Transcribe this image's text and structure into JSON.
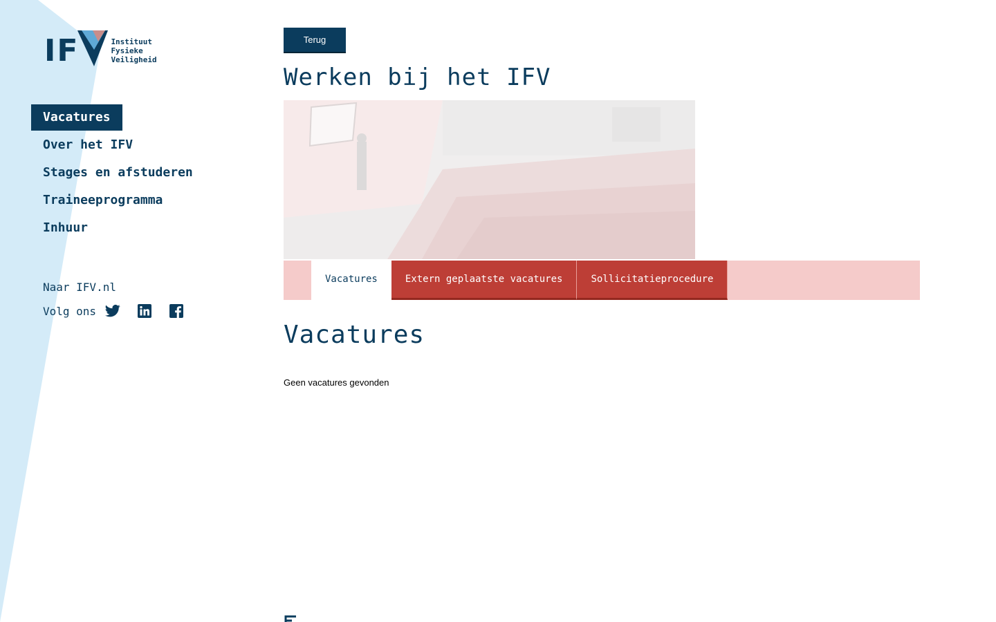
{
  "logo": {
    "letters": "IF",
    "tagline": [
      "Instituut",
      "Fysieke",
      "Veiligheid"
    ],
    "colors": {
      "navy": "#0b3c5d",
      "light_blue": "#5fa9d6",
      "red": "#bd3e36"
    }
  },
  "sidebar": {
    "nav": [
      {
        "label": "Vacatures",
        "active": true
      },
      {
        "label": "Over het IFV",
        "active": false
      },
      {
        "label": "Stages en afstuderen",
        "active": false
      },
      {
        "label": "Traineeprogramma",
        "active": false
      },
      {
        "label": "Inhuur",
        "active": false
      }
    ],
    "site_link": "Naar IFV.nl",
    "follow_label": "Volg ons",
    "social_icons": [
      "twitter-icon",
      "linkedin-icon",
      "facebook-icon"
    ]
  },
  "main": {
    "back_label": "Terug",
    "page_title": "Werken bij het IFV",
    "tabs": [
      {
        "label": "Vacatures",
        "active": true
      },
      {
        "label": "Extern geplaatste vacatures",
        "active": false
      },
      {
        "label": "Sollicitatieprocedure",
        "active": false
      }
    ],
    "section_title": "Vacatures",
    "empty_message": "Geen vacatures gevonden"
  },
  "colors": {
    "navy": "#0b3c5d",
    "tab_red": "#bd3e36",
    "tabbar_pink": "#f5cbca",
    "bg_shape": "#d4ebf8"
  }
}
